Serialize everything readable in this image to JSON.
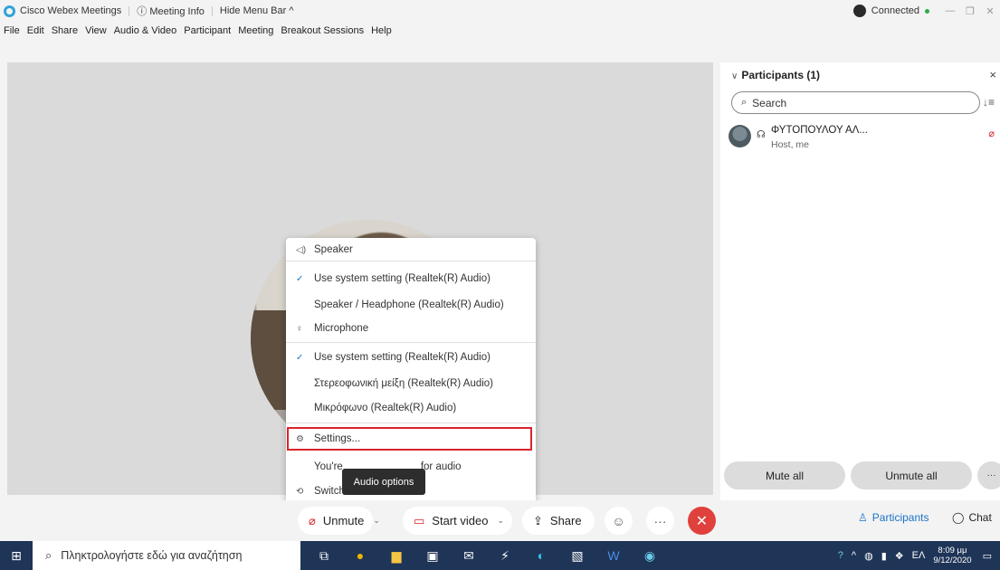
{
  "titlebar": {
    "app_name": "Cisco Webex Meetings",
    "meeting_info": "Meeting Info",
    "hide_menu_bar": "Hide Menu Bar",
    "status": "Connected"
  },
  "menubar": [
    "File",
    "Edit",
    "Share",
    "View",
    "Audio & Video",
    "Participant",
    "Meeting",
    "Breakout Sessions",
    "Help"
  ],
  "audio_menu": {
    "speaker_heading": "Speaker",
    "speaker_options": [
      "Use system setting (Realtek(R) Audio)",
      "Speaker / Headphone (Realtek(R) Audio)"
    ],
    "microphone_heading": "Microphone",
    "microphone_options": [
      "Use system setting (Realtek(R) Audio)",
      "Στερεοφωνική μείξη (Realtek(R) Audio)",
      "Μικρόφωνο (Realtek(R) Audio)"
    ],
    "settings": "Settings...",
    "status_prefix": "You're",
    "status_suffix": "for audio",
    "switch": "Switch"
  },
  "tooltip": "Audio options",
  "controls": {
    "unmute": "Unmute",
    "start_video": "Start video",
    "share": "Share",
    "participants": "Participants",
    "chat": "Chat"
  },
  "panel": {
    "title": "Participants (1)",
    "search_placeholder": "Search",
    "participant_name": "ΦΥΤΟΠΟΥΛΟΥ ΑΛ...",
    "participant_role": "Host, me",
    "mute_all": "Mute all",
    "unmute_all": "Unmute all"
  },
  "taskbar": {
    "search_placeholder": "Πληκτρολογήστε εδώ για αναζήτηση",
    "language": "ΕΛ",
    "time": "8:09 μμ",
    "date": "9/12/2020"
  },
  "colors": {
    "accent_red": "#d9232d",
    "accent_blue": "#1a73c7",
    "taskbar": "#1f3557"
  }
}
